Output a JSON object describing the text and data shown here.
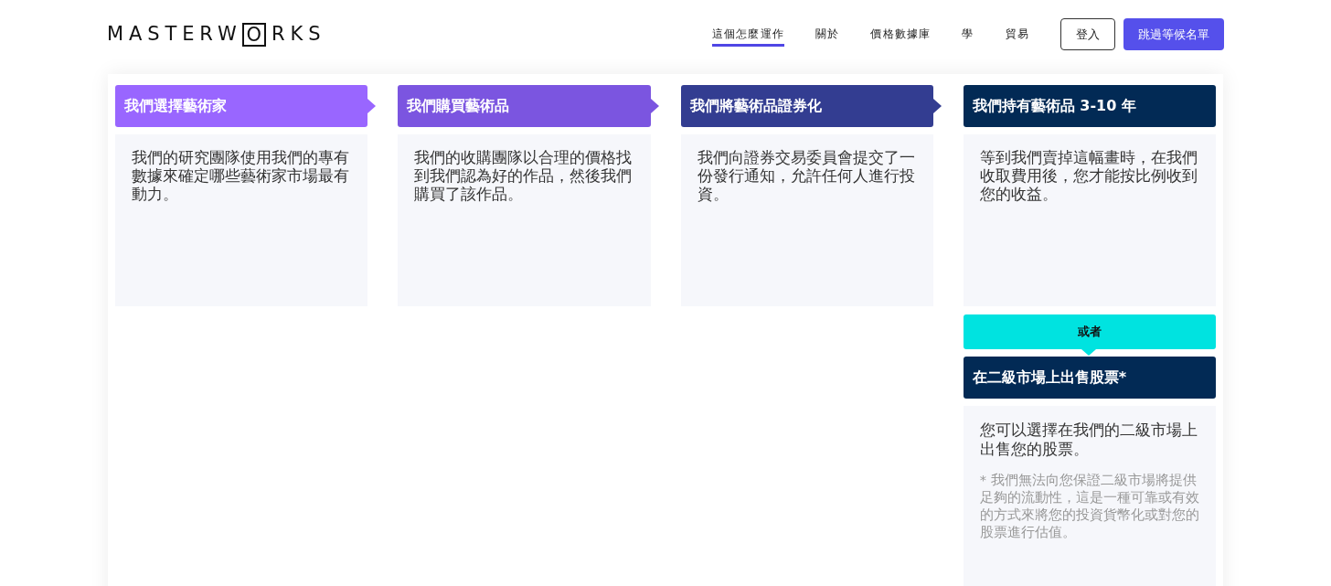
{
  "logo": {
    "before": "MASTERW",
    "boxed": "O",
    "after": "RKS"
  },
  "nav": [
    {
      "label": "這個怎麼運作",
      "selected": true
    },
    {
      "label": "關於",
      "selected": false
    },
    {
      "label": "價格數據庫",
      "selected": false
    },
    {
      "label": "學",
      "selected": false
    },
    {
      "label": "貿易",
      "selected": false
    }
  ],
  "login_button": "登入",
  "waitlist_button": "跳過等候名單",
  "steps": [
    {
      "title": "我們選擇藝術家",
      "color": "#9966ff",
      "arrow": true,
      "body": "我們的研究團隊使用我們的專有數據來確定哪些藝術家市場最有動力。"
    },
    {
      "title": "我們購買藝術品",
      "color": "#7b55e0",
      "arrow": true,
      "body": "我們的收購團隊以合理的價格找到我們認為好的作品，然後我們購買了該作品。"
    },
    {
      "title": "我們將藝術品證券化",
      "color": "#333d91",
      "arrow": true,
      "body": "我們向證券交易委員會提交了一份發行通知，允許任何人進行投資。"
    },
    {
      "title": "我們持有藝術品 3-10 年",
      "color": "#022a55",
      "arrow": false,
      "body": "等到我們賣掉這幅畫時，在我們收取費用後，您才能按比例收到您的收益。"
    }
  ],
  "alternative": {
    "divider": "或者",
    "title": "在二級市場上出售股票*",
    "body": "您可以選擇在我們的二級市場上出售您的股票。",
    "footnote": "* 我們無法向您保證二級市場將提供足夠的流動性，這是一種可靠或有效的方式來將您的投資貨幣化或對您的股票進行估值。"
  }
}
